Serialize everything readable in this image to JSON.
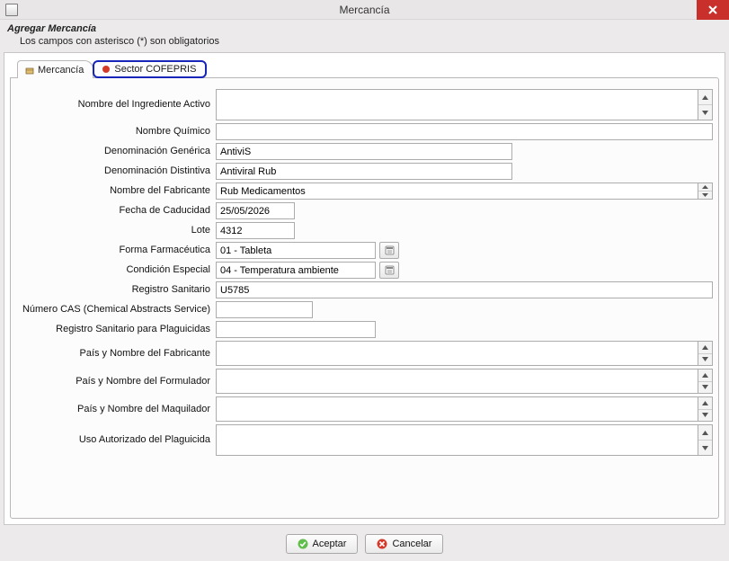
{
  "window": {
    "title": "Mercancía"
  },
  "header": {
    "title": "Agregar Mercancía",
    "subtitle": "Los campos con asterisco (*) son obligatorios"
  },
  "tabs": {
    "mercancia": "Mercancía",
    "cofepris": "Sector COFEPRIS"
  },
  "labels": {
    "nombreIngredienteActivo": "Nombre del Ingrediente Activo",
    "nombreQuimico": "Nombre Químico",
    "denominacionGenerica": "Denominación Genérica",
    "denominacionDistintiva": "Denominación Distintiva",
    "nombreFabricante": "Nombre del Fabricante",
    "fechaCaducidad": "Fecha de Caducidad",
    "lote": "Lote",
    "formaFarmaceutica": "Forma Farmacéutica",
    "condicionEspecial": "Condición Especial",
    "registroSanitario": "Registro Sanitario",
    "numeroCAS": "Número CAS (Chemical Abstracts Service)",
    "registroPlaguicidas": "Registro Sanitario para Plaguicidas",
    "paisFabricante": "País y Nombre del Fabricante",
    "paisFormulador": "País y Nombre del Formulador",
    "paisMaquilador": "País y Nombre del Maquilador",
    "usoAutorizado": "Uso Autorizado del Plaguicida"
  },
  "values": {
    "nombreIngredienteActivo": "",
    "nombreQuimico": "",
    "denominacionGenerica": "AntiviS",
    "denominacionDistintiva": "Antiviral Rub",
    "nombreFabricante": "Rub Medicamentos",
    "fechaCaducidad": "25/05/2026",
    "lote": "4312",
    "formaFarmaceutica": "01 - Tableta",
    "condicionEspecial": "04 - Temperatura ambiente",
    "registroSanitario": "U5785",
    "numeroCAS": "",
    "registroPlaguicidas": "",
    "paisFabricante": "",
    "paisFormulador": "",
    "paisMaquilador": "",
    "usoAutorizado": ""
  },
  "buttons": {
    "accept": "Aceptar",
    "cancel": "Cancelar"
  }
}
